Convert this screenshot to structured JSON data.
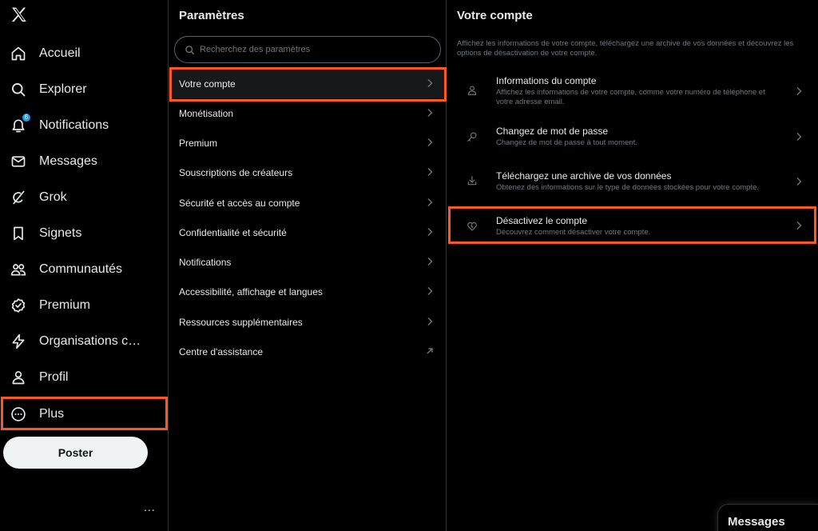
{
  "nav": {
    "logo": "x-logo-icon",
    "items": [
      {
        "label": "Accueil",
        "icon": "home-icon"
      },
      {
        "label": "Explorer",
        "icon": "search-icon"
      },
      {
        "label": "Notifications",
        "icon": "bell-icon",
        "badge": "6"
      },
      {
        "label": "Messages",
        "icon": "envelope-icon"
      },
      {
        "label": "Grok",
        "icon": "grok-icon"
      },
      {
        "label": "Signets",
        "icon": "bookmark-icon"
      },
      {
        "label": "Communautés",
        "icon": "people-icon"
      },
      {
        "label": "Premium",
        "icon": "verified-icon"
      },
      {
        "label": "Organisations cer...",
        "icon": "lightning-icon"
      },
      {
        "label": "Profil",
        "icon": "person-icon"
      },
      {
        "label": "Plus",
        "icon": "more-circle-icon"
      }
    ],
    "post_button": "Poster",
    "more_dots": "..."
  },
  "settings": {
    "title": "Paramètres",
    "search_placeholder": "Recherchez des paramètres",
    "items": [
      {
        "label": "Votre compte",
        "active": true
      },
      {
        "label": "Monétisation"
      },
      {
        "label": "Premium"
      },
      {
        "label": "Souscriptions de créateurs"
      },
      {
        "label": "Sécurité et accès au compte"
      },
      {
        "label": "Confidentialité et sécurité"
      },
      {
        "label": "Notifications"
      },
      {
        "label": "Accessibilité, affichage et langues"
      },
      {
        "label": "Ressources supplémentaires"
      },
      {
        "label": "Centre d'assistance",
        "external": true
      }
    ]
  },
  "account": {
    "title": "Votre compte",
    "description": "Affichez les informations de votre compte, téléchargez une archive de vos données et découvrez les options de désactivation de votre compte.",
    "items": [
      {
        "title": "Informations du compte",
        "desc": "Affichez les informations de votre compte, comme votre numéro de téléphone et votre adresse email.",
        "icon": "person-icon"
      },
      {
        "title": "Changez de mot de passe",
        "desc": "Changez de mot de passe à tout moment.",
        "icon": "key-icon"
      },
      {
        "title": "Téléchargez une archive de vos données",
        "desc": "Obtenez des informations sur le type de données stockées pour votre compte.",
        "icon": "download-icon"
      },
      {
        "title": "Désactivez le compte",
        "desc": "Découvrez comment désactiver votre compte.",
        "icon": "broken-heart-icon"
      }
    ]
  },
  "messages_drawer": {
    "label": "Messages"
  },
  "colors": {
    "highlight": "#ff5722",
    "accent": "#1d9bf0",
    "background": "#000000",
    "muted": "#71767b"
  }
}
